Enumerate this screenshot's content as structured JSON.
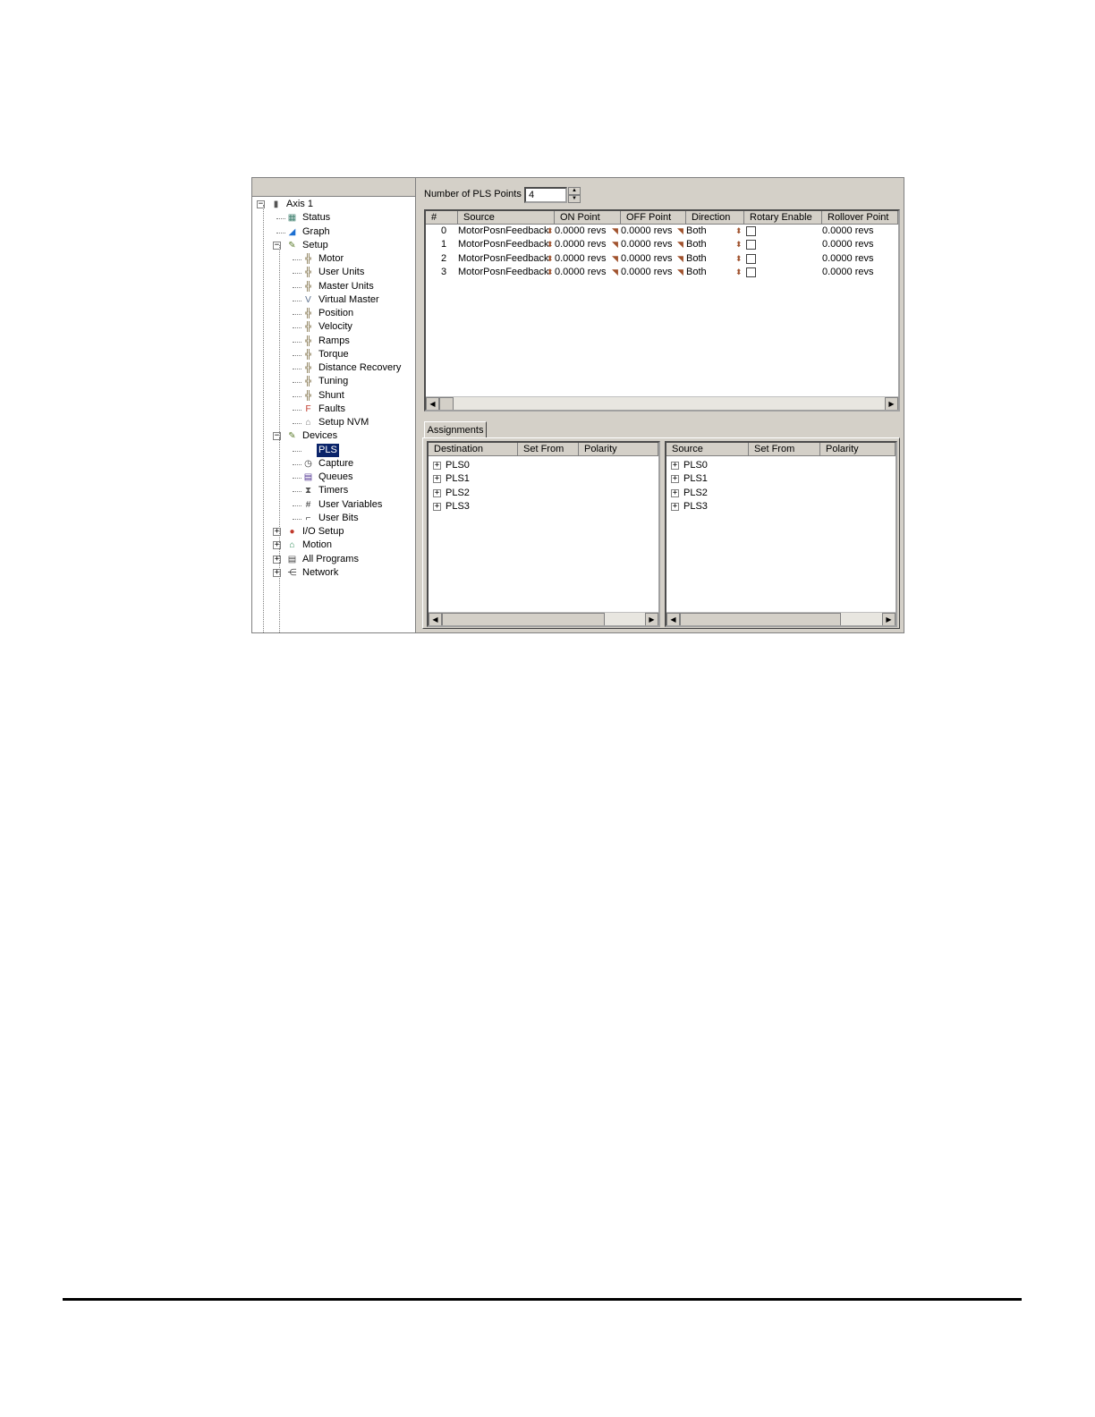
{
  "tree": {
    "nodes": [
      {
        "label": "Axis 1",
        "icon": "axis-icon",
        "level": 0,
        "expander": "−"
      },
      {
        "label": "Status",
        "icon": "status-icon",
        "level": 1
      },
      {
        "label": "Graph",
        "icon": "graph-icon",
        "level": 1
      },
      {
        "label": "Setup",
        "icon": "setup-icon",
        "level": 1,
        "expander": "−"
      },
      {
        "label": "Motor",
        "icon": "motor-icon",
        "level": 2
      },
      {
        "label": "User Units",
        "icon": "user-units-icon",
        "level": 2
      },
      {
        "label": "Master Units",
        "icon": "master-units-icon",
        "level": 2
      },
      {
        "label": "Virtual Master",
        "icon": "virtual-master-icon",
        "level": 2
      },
      {
        "label": "Position",
        "icon": "position-icon",
        "level": 2
      },
      {
        "label": "Velocity",
        "icon": "velocity-icon",
        "level": 2
      },
      {
        "label": "Ramps",
        "icon": "ramps-icon",
        "level": 2
      },
      {
        "label": "Torque",
        "icon": "torque-icon",
        "level": 2
      },
      {
        "label": "Distance Recovery",
        "icon": "distance-recovery-icon",
        "level": 2
      },
      {
        "label": "Tuning",
        "icon": "tuning-icon",
        "level": 2
      },
      {
        "label": "Shunt",
        "icon": "shunt-icon",
        "level": 2
      },
      {
        "label": "Faults",
        "icon": "faults-icon",
        "level": 2
      },
      {
        "label": "Setup NVM",
        "icon": "setup-nvm-icon",
        "level": 2
      },
      {
        "label": "Devices",
        "icon": "devices-icon",
        "level": 1,
        "expander": "−"
      },
      {
        "label": "PLS",
        "icon": "",
        "level": 2,
        "selected": true
      },
      {
        "label": "Capture",
        "icon": "capture-icon",
        "level": 2
      },
      {
        "label": "Queues",
        "icon": "queues-icon",
        "level": 2
      },
      {
        "label": "Timers",
        "icon": "timers-icon",
        "level": 2
      },
      {
        "label": "User Variables",
        "icon": "user-variables-icon",
        "level": 2
      },
      {
        "label": "User Bits",
        "icon": "user-bits-icon",
        "level": 2
      },
      {
        "label": "I/O Setup",
        "icon": "io-setup-icon",
        "level": 1,
        "expander": "+"
      },
      {
        "label": "Motion",
        "icon": "motion-icon",
        "level": 1,
        "expander": "+"
      },
      {
        "label": "All Programs",
        "icon": "all-programs-icon",
        "level": 1,
        "expander": "+"
      },
      {
        "label": "Network",
        "icon": "network-icon",
        "level": 1,
        "expander": "+"
      }
    ]
  },
  "pls_points": {
    "label": "Number of PLS Points",
    "value": "4"
  },
  "pls_table": {
    "columns": [
      "#",
      "Source",
      "ON Point",
      "OFF Point",
      "Direction",
      "Rotary Enable",
      "Rollover Point"
    ],
    "rows": [
      {
        "index": "0",
        "source": "MotorPosnFeedback",
        "on": "0.0000 revs",
        "off": "0.0000 revs",
        "direction": "Both",
        "rollover": "0.0000 revs"
      },
      {
        "index": "1",
        "source": "MotorPosnFeedback",
        "on": "0.0000 revs",
        "off": "0.0000 revs",
        "direction": "Both",
        "rollover": "0.0000 revs"
      },
      {
        "index": "2",
        "source": "MotorPosnFeedback",
        "on": "0.0000 revs",
        "off": "0.0000 revs",
        "direction": "Both",
        "rollover": "0.0000 revs"
      },
      {
        "index": "3",
        "source": "MotorPosnFeedback",
        "on": "0.0000 revs",
        "off": "0.0000 revs",
        "direction": "Both",
        "rollover": "0.0000 revs"
      }
    ]
  },
  "assignments": {
    "tab": "Assignments",
    "left": {
      "columns": [
        "Destination",
        "Set From",
        "Polarity"
      ],
      "items": [
        "PLS0",
        "PLS1",
        "PLS2",
        "PLS3"
      ]
    },
    "right": {
      "columns": [
        "Source",
        "Set From",
        "Polarity"
      ],
      "items": [
        "PLS0",
        "PLS1",
        "PLS2",
        "PLS3"
      ]
    }
  }
}
